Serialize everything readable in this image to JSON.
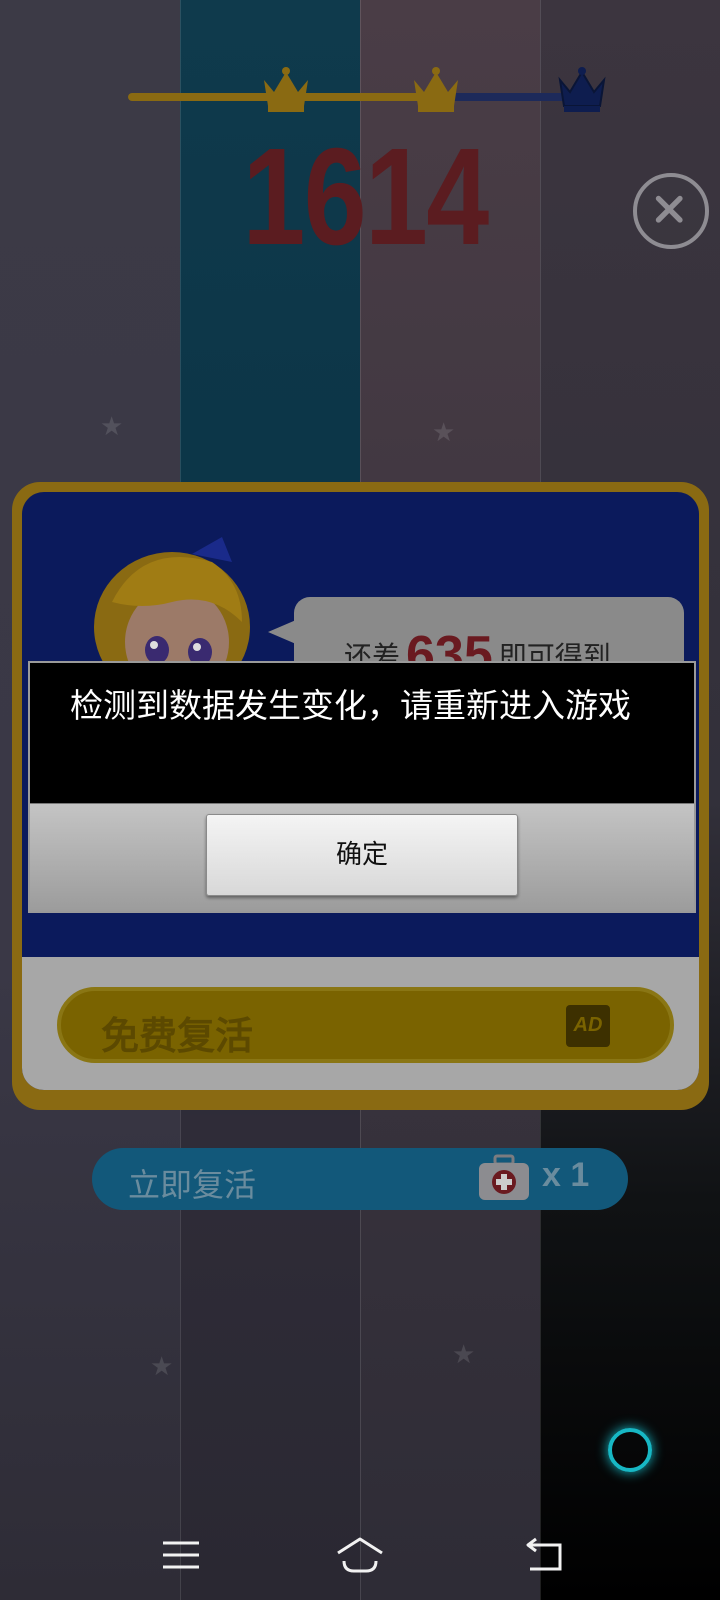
{
  "game": {
    "score": "1614",
    "progress_fraction": 0.72,
    "crowns": [
      "gold-crown-icon",
      "gold-crown-icon",
      "navy-crown-icon"
    ]
  },
  "revive_panel": {
    "bubble_prefix": "还差",
    "points_needed": "635",
    "bubble_suffix": "即可得到",
    "free_revive_label": "免费复活",
    "ad_badge": "AD",
    "instant_revive_label": "立即复活",
    "revive_count": "x 1"
  },
  "dialog": {
    "message": "检测到数据发生变化，请重新进入游戏",
    "confirm_label": "确定"
  },
  "colors": {
    "gold_dim": "#8a6a12",
    "panel_blue": "#0b1a5c",
    "score_red": "#5b1c20",
    "accent_cyan": "#17b7c4"
  },
  "nav": {
    "icons": [
      "menu-icon",
      "home-icon",
      "back-icon"
    ]
  }
}
